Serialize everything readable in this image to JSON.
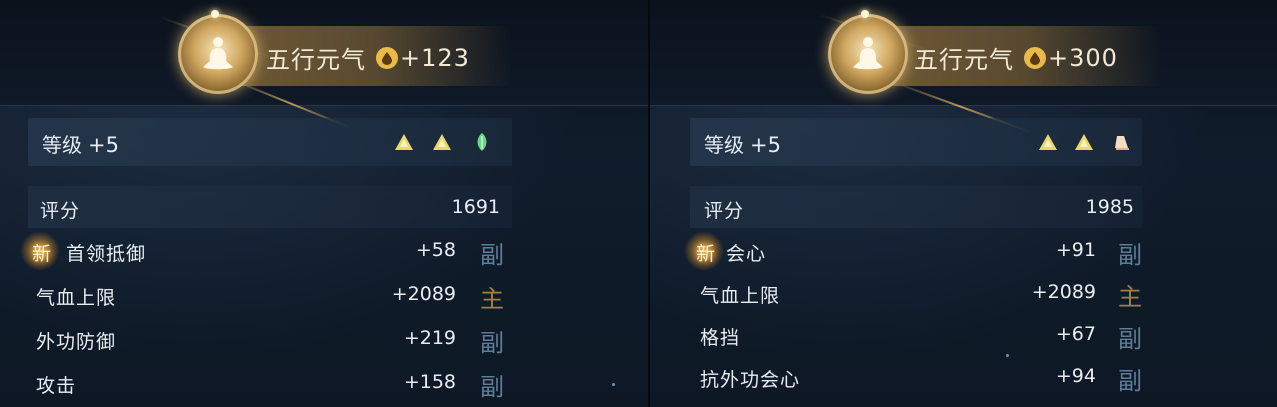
{
  "panels": [
    {
      "header": {
        "title": "五行元气",
        "bonus": "+123"
      },
      "level": {
        "label": "等级",
        "value": "+5",
        "gems": [
          "gold-triangle-gem-icon",
          "gold-triangle-gem-icon",
          "green-leaf-gem-icon"
        ]
      },
      "score": {
        "label": "评分",
        "value": "1691"
      },
      "stats": [
        {
          "new": "新",
          "name": "首领抵御",
          "value": "+58",
          "tag": "副",
          "tag_type": "sub"
        },
        {
          "new": "",
          "name": "气血上限",
          "value": "+2089",
          "tag": "主",
          "tag_type": "main"
        },
        {
          "new": "",
          "name": "外功防御",
          "value": "+219",
          "tag": "副",
          "tag_type": "sub"
        },
        {
          "new": "",
          "name": "攻击",
          "value": "+158",
          "tag": "副",
          "tag_type": "sub"
        }
      ]
    },
    {
      "header": {
        "title": "五行元气",
        "bonus": "+300"
      },
      "level": {
        "label": "等级",
        "value": "+5",
        "gems": [
          "gold-triangle-gem-icon",
          "gold-triangle-gem-icon",
          "earth-gem-icon"
        ]
      },
      "score": {
        "label": "评分",
        "value": "1985"
      },
      "stats": [
        {
          "new": "新",
          "name": "会心",
          "value": "+91",
          "tag": "副",
          "tag_type": "sub"
        },
        {
          "new": "",
          "name": "气血上限",
          "value": "+2089",
          "tag": "主",
          "tag_type": "main"
        },
        {
          "new": "",
          "name": "格挡",
          "value": "+67",
          "tag": "副",
          "tag_type": "sub"
        },
        {
          "new": "",
          "name": "抗外功会心",
          "value": "+94",
          "tag": "副",
          "tag_type": "sub"
        }
      ]
    }
  ],
  "colors": {
    "gold": "#e9b94a",
    "sub_tag": "#5d7d99",
    "main_tag": "#a07f48",
    "background": "#0b1420"
  }
}
